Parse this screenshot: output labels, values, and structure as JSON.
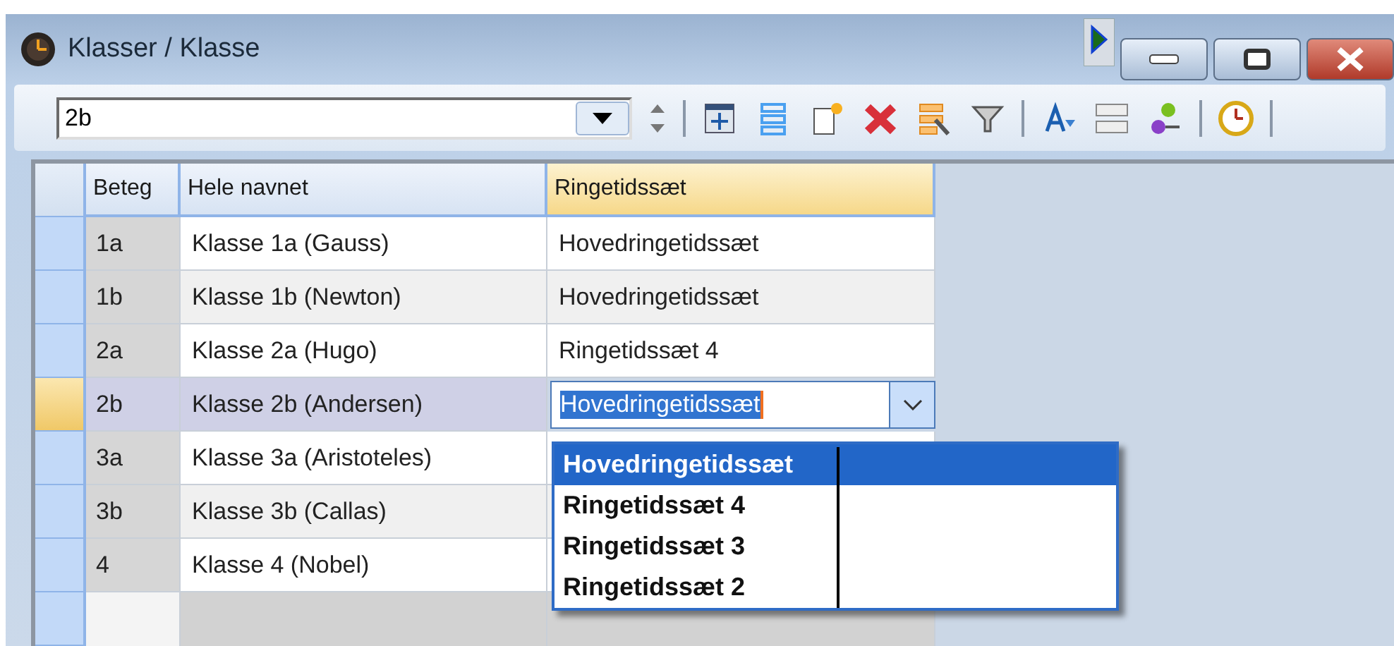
{
  "window": {
    "title": "Klasser / Klasse"
  },
  "toolbar": {
    "field_value": "2b"
  },
  "table": {
    "columns": [
      "Beteg",
      "Hele navnet",
      "Ringetidssæt"
    ],
    "rows": [
      {
        "code": "1a",
        "name": "Klasse 1a (Gauss)",
        "bell": "Hovedringetidssæt",
        "selected": false
      },
      {
        "code": "1b",
        "name": "Klasse 1b (Newton)",
        "bell": "Hovedringetidssæt",
        "selected": false
      },
      {
        "code": "2a",
        "name": "Klasse 2a (Hugo)",
        "bell": "Ringetidssæt 4",
        "selected": false
      },
      {
        "code": "2b",
        "name": "Klasse 2b (Andersen)",
        "bell": "Hovedringetidssæt",
        "selected": true
      },
      {
        "code": "3a",
        "name": "Klasse 3a (Aristoteles)",
        "bell": "",
        "selected": false
      },
      {
        "code": "3b",
        "name": "Klasse 3b (Callas)",
        "bell": "",
        "selected": false
      },
      {
        "code": "4",
        "name": "Klasse 4 (Nobel)",
        "bell": "",
        "selected": false
      }
    ]
  },
  "dropdown": {
    "options": [
      {
        "label": "Hovedringetidssæt",
        "selected": true
      },
      {
        "label": "Ringetidssæt 4",
        "selected": false
      },
      {
        "label": "Ringetidssæt 3",
        "selected": false
      },
      {
        "label": "Ringetidssæt 2",
        "selected": false
      }
    ]
  }
}
